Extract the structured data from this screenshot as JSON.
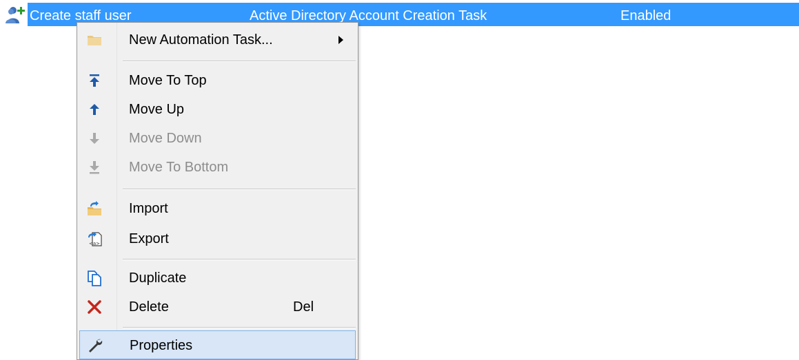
{
  "list_row": {
    "name": "Create staff user",
    "type": "Active Directory Account Creation Task",
    "status": "Enabled",
    "icon": "user-add-icon",
    "selected_color": "#3399ff"
  },
  "context_menu": {
    "new_task": {
      "label": "New Automation Task...",
      "icon": "folder-icon",
      "has_submenu": true
    },
    "move_to_top": {
      "label": "Move To Top",
      "icon": "arrow-to-top-icon"
    },
    "move_up": {
      "label": "Move Up",
      "icon": "arrow-up-icon"
    },
    "move_down": {
      "label": "Move Down",
      "icon": "arrow-down-icon",
      "disabled": true
    },
    "move_to_bottom": {
      "label": "Move To Bottom",
      "icon": "arrow-to-bottom-icon",
      "disabled": true
    },
    "import": {
      "label": "Import",
      "icon": "import-folder-icon"
    },
    "export": {
      "label": "Export",
      "icon": "export-icon"
    },
    "duplicate": {
      "label": "Duplicate",
      "icon": "duplicate-icon"
    },
    "delete": {
      "label": "Delete",
      "shortcut": "Del",
      "icon": "delete-x-icon"
    },
    "properties": {
      "label": "Properties",
      "icon": "wrench-icon",
      "hovered": true
    }
  }
}
